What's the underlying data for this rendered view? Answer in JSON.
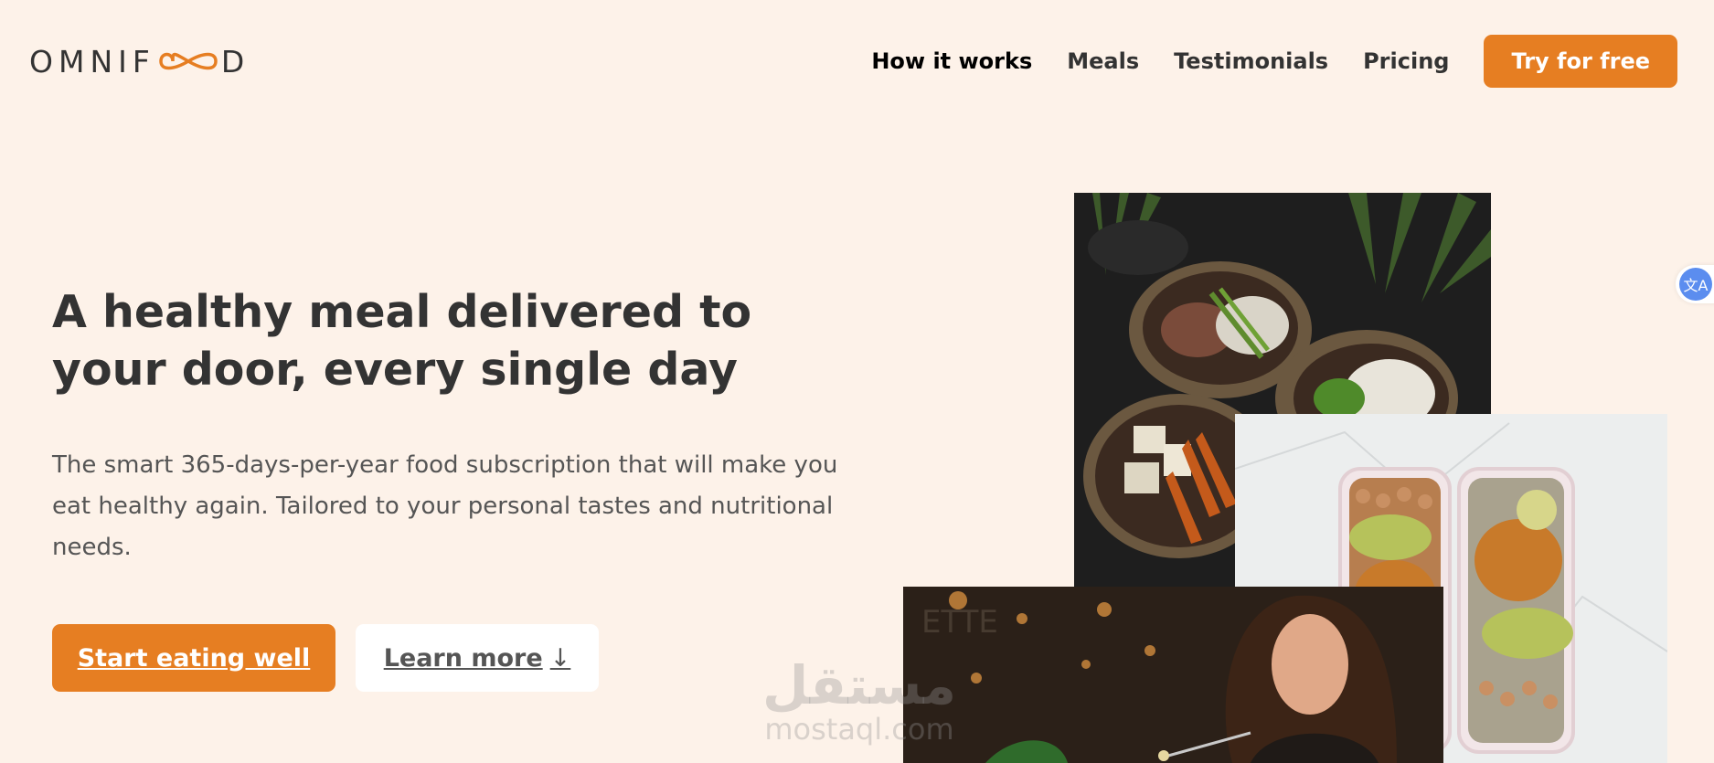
{
  "brand": {
    "logo_left": "OMNIF",
    "logo_right": "D",
    "accent_color": "#e67e22",
    "background_color": "#fdf2e9"
  },
  "nav": {
    "items": [
      {
        "label": "How it works",
        "active": true
      },
      {
        "label": "Meals",
        "active": false
      },
      {
        "label": "Testimonials",
        "active": false
      },
      {
        "label": "Pricing",
        "active": false
      }
    ],
    "cta_label": "Try for free"
  },
  "hero": {
    "title": "A healthy meal delivered to your door, every single day",
    "description": "The smart 365-days-per-year food subscription that will make you eat healthy again. Tailored to your personal tastes and nutritional needs.",
    "primary_button": "Start eating well",
    "secondary_button": "Learn more",
    "secondary_arrow": "↓"
  },
  "images": [
    {
      "name": "meal-bowls-photo",
      "icon": "food-bowls-image"
    },
    {
      "name": "meal-prep-containers-photo",
      "icon": "meal-containers-image"
    },
    {
      "name": "woman-eating-photo",
      "icon": "woman-eating-image"
    }
  ],
  "translate_widget": {
    "icon": "translate-icon",
    "glyph": "文A"
  },
  "watermark": {
    "arabic": "مستقل",
    "domain": "mostaql.com"
  }
}
